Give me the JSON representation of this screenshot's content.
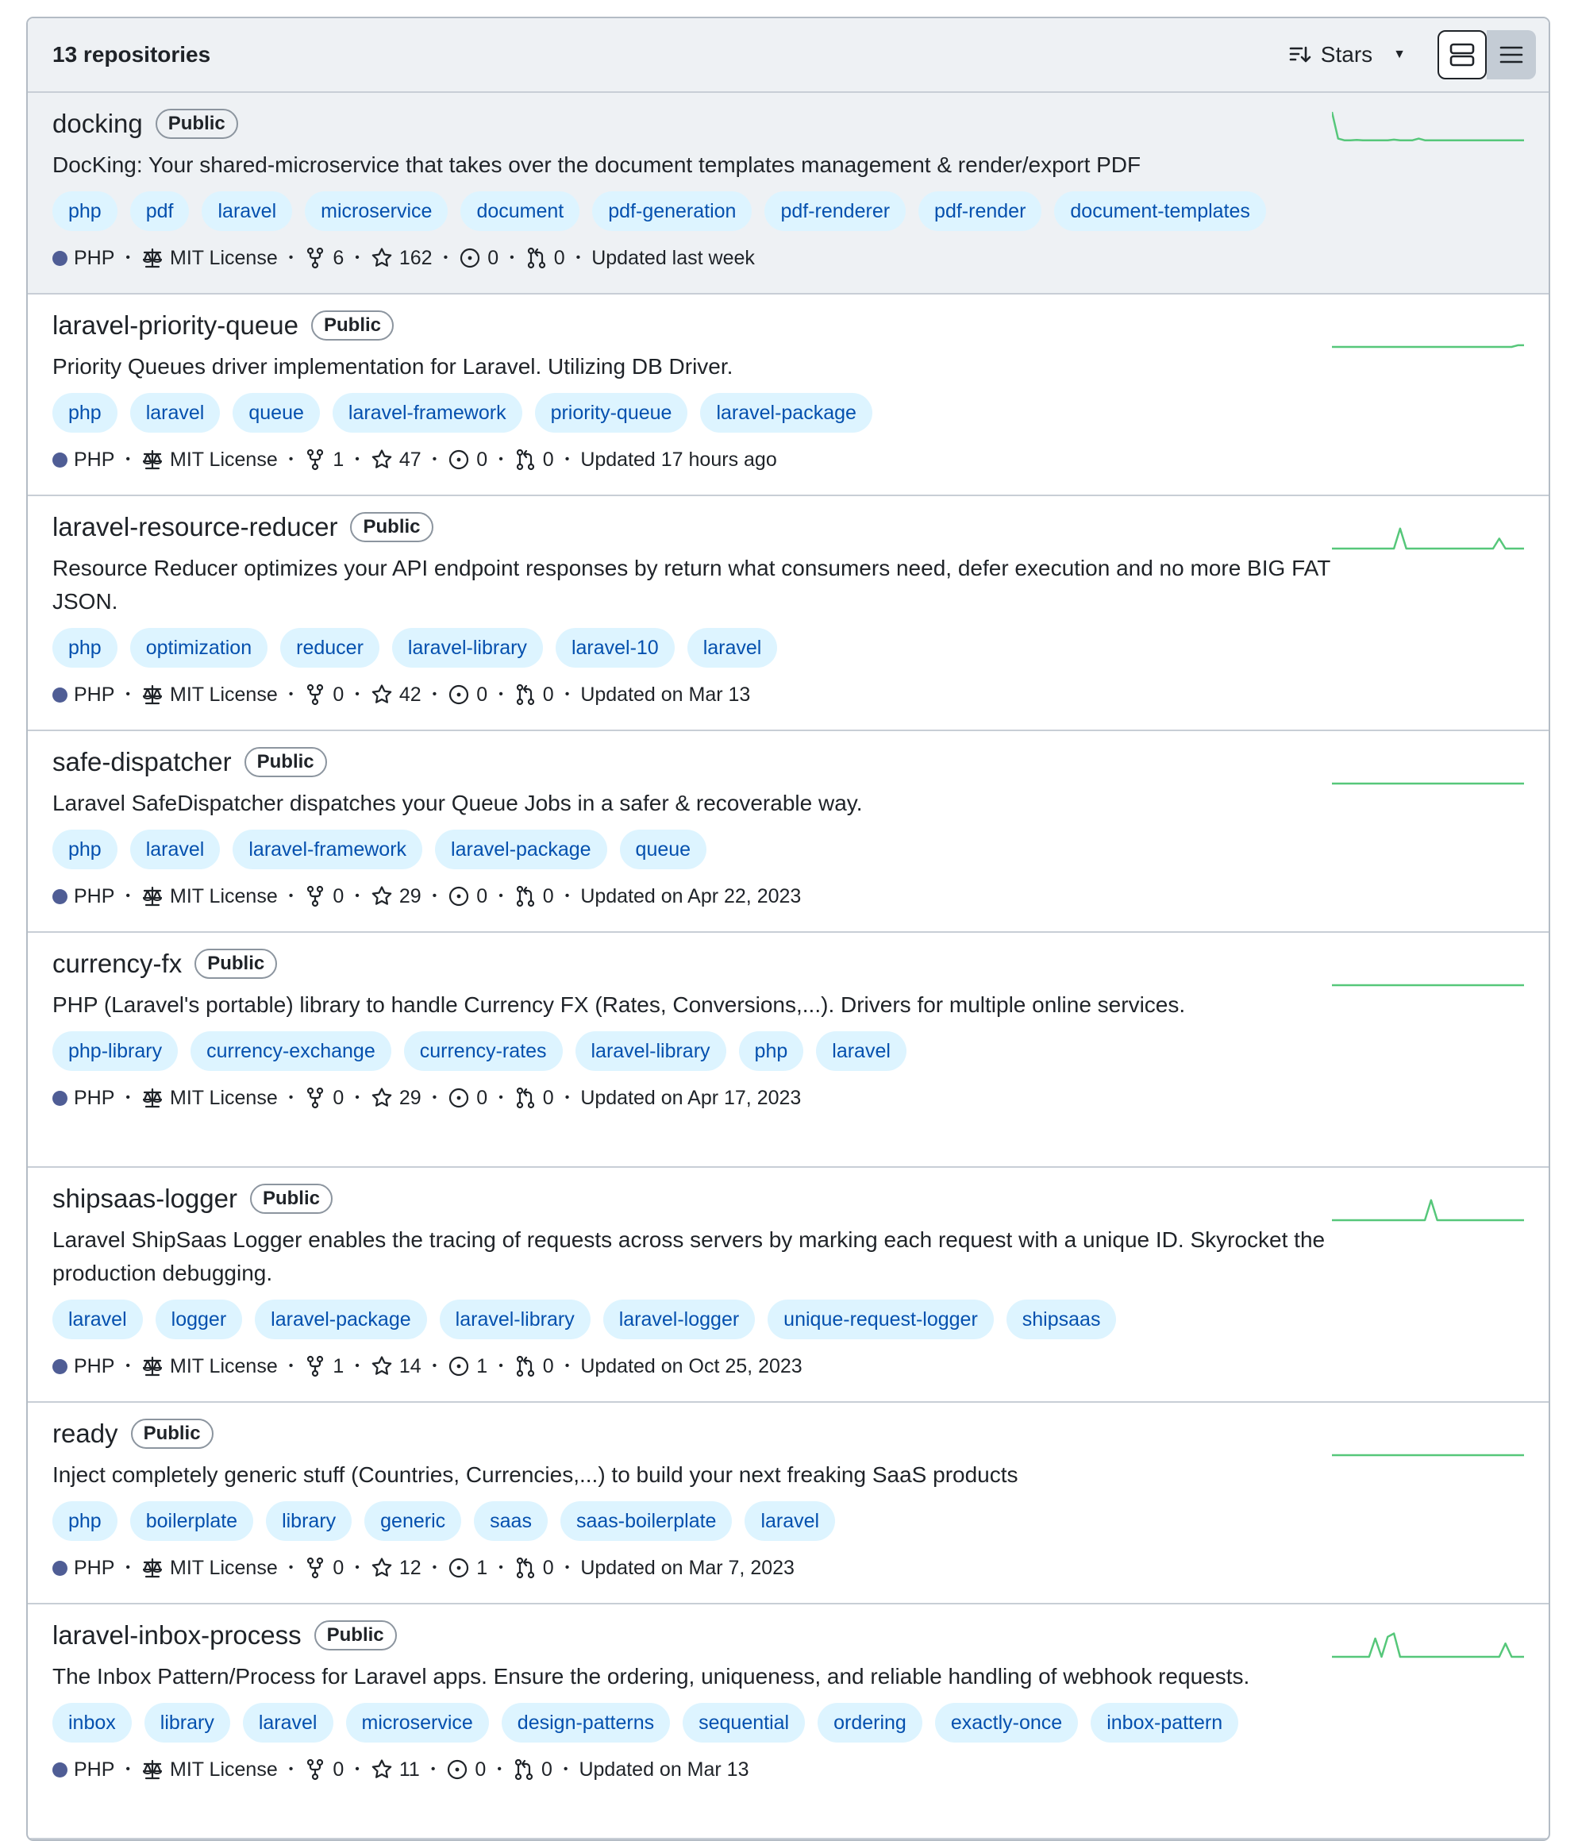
{
  "header": {
    "count_label": "13 repositories",
    "sort_label": "Stars"
  },
  "colors": {
    "php_language": "#4f5d95",
    "topic_bg": "#ddf4ff",
    "topic_text": "#0550ae",
    "sparkline": "#56c77a"
  },
  "icons": {
    "sort": "sort-descending-icon",
    "caret": "triangle-down-icon",
    "card_view": "card-view-icon",
    "list_view": "list-view-icon",
    "license": "law-scale-icon",
    "forks": "repo-forked-icon",
    "stars": "star-icon",
    "issues": "issue-opened-icon",
    "pulls": "git-pull-request-icon"
  },
  "repos": [
    {
      "name": "docking",
      "visibility": "Public",
      "description": "DocKing: Your shared-microservice that takes over the document templates management & render/export PDF",
      "topics": [
        "php",
        "pdf",
        "laravel",
        "microservice",
        "document",
        "pdf-generation",
        "pdf-renderer",
        "pdf-render",
        "document-templates"
      ],
      "language": "PHP",
      "license": "MIT License",
      "forks": "6",
      "stars": "162",
      "issues": "0",
      "pulls": "0",
      "updated": "Updated last week",
      "activity": [
        1,
        0.2,
        0.15,
        0.15,
        0.16,
        0.15,
        0.15,
        0.15,
        0.15,
        0.15,
        0.17,
        0.15,
        0.15,
        0.15,
        0.2,
        0.15,
        0.15,
        0.15,
        0.15,
        0.15,
        0.15,
        0.15,
        0.15,
        0.15,
        0.15,
        0.15,
        0.15,
        0.15,
        0.15,
        0.15,
        0.15,
        0.15
      ]
    },
    {
      "name": "laravel-priority-queue",
      "visibility": "Public",
      "description": "Priority Queues driver implementation for Laravel. Utilizing DB Driver.",
      "topics": [
        "php",
        "laravel",
        "queue",
        "laravel-framework",
        "priority-queue",
        "laravel-package"
      ],
      "language": "PHP",
      "license": "MIT License",
      "forks": "1",
      "stars": "47",
      "issues": "0",
      "pulls": "0",
      "updated": "Updated 17 hours ago",
      "activity": [
        0,
        0,
        0,
        0,
        0,
        0,
        0,
        0,
        0,
        0,
        0,
        0,
        0,
        0,
        0,
        0,
        0,
        0,
        0,
        0,
        0,
        0,
        0,
        0,
        0,
        0,
        0,
        0,
        0,
        0,
        0.05,
        0.05
      ]
    },
    {
      "name": "laravel-resource-reducer",
      "visibility": "Public",
      "description": "Resource Reducer optimizes your API endpoint responses by return what consumers need, defer execution and no more BIG FAT JSON.",
      "topics": [
        "php",
        "optimization",
        "reducer",
        "laravel-library",
        "laravel-10",
        "laravel"
      ],
      "language": "PHP",
      "license": "MIT License",
      "forks": "0",
      "stars": "42",
      "issues": "0",
      "pulls": "0",
      "updated": "Updated on Mar 13",
      "activity": [
        0,
        0,
        0,
        0,
        0,
        0,
        0,
        0,
        0,
        0,
        0,
        0.6,
        0,
        0,
        0,
        0,
        0,
        0,
        0,
        0,
        0,
        0,
        0,
        0,
        0,
        0,
        0,
        0.3,
        0,
        0,
        0,
        0
      ]
    },
    {
      "name": "safe-dispatcher",
      "visibility": "Public",
      "description": "Laravel SafeDispatcher dispatches your Queue Jobs in a safer & recoverable way.",
      "topics": [
        "php",
        "laravel",
        "laravel-framework",
        "laravel-package",
        "queue"
      ],
      "language": "PHP",
      "license": "MIT License",
      "forks": "0",
      "stars": "29",
      "issues": "0",
      "pulls": "0",
      "updated": "Updated on Apr 22, 2023",
      "activity": [
        0,
        0,
        0,
        0,
        0,
        0,
        0,
        0,
        0,
        0,
        0,
        0,
        0,
        0,
        0,
        0,
        0,
        0,
        0,
        0,
        0,
        0,
        0,
        0,
        0,
        0,
        0,
        0,
        0,
        0,
        0,
        0
      ]
    },
    {
      "name": "currency-fx",
      "visibility": "Public",
      "description": "PHP (Laravel's portable) library to handle Currency FX (Rates, Conversions,...). Drivers for multiple online services.",
      "topics": [
        "php-library",
        "currency-exchange",
        "currency-rates",
        "laravel-library",
        "php",
        "laravel"
      ],
      "language": "PHP",
      "license": "MIT License",
      "forks": "0",
      "stars": "29",
      "issues": "0",
      "pulls": "0",
      "updated": "Updated on Apr 17, 2023",
      "activity": [
        0,
        0,
        0,
        0,
        0,
        0,
        0,
        0,
        0,
        0,
        0,
        0,
        0,
        0,
        0,
        0,
        0,
        0,
        0,
        0,
        0,
        0,
        0,
        0,
        0,
        0,
        0,
        0,
        0,
        0,
        0,
        0
      ]
    },
    {
      "name": "shipsaas-logger",
      "visibility": "Public",
      "description": "Laravel ShipSaas Logger enables the tracing of requests across servers by marking each request with a unique ID. Skyrocket the production debugging.",
      "topics": [
        "laravel",
        "logger",
        "laravel-package",
        "laravel-library",
        "laravel-logger",
        "unique-request-logger",
        "shipsaas"
      ],
      "language": "PHP",
      "license": "MIT License",
      "forks": "1",
      "stars": "14",
      "issues": "1",
      "pulls": "0",
      "updated": "Updated on Oct 25, 2023",
      "activity": [
        0,
        0,
        0,
        0,
        0,
        0,
        0,
        0,
        0,
        0,
        0,
        0,
        0,
        0,
        0,
        0,
        0.6,
        0,
        0,
        0,
        0,
        0,
        0,
        0,
        0,
        0,
        0,
        0,
        0,
        0,
        0,
        0
      ]
    },
    {
      "name": "ready",
      "visibility": "Public",
      "description": "Inject completely generic stuff (Countries, Currencies,...) to build your next freaking SaaS products",
      "topics": [
        "php",
        "boilerplate",
        "library",
        "generic",
        "saas",
        "saas-boilerplate",
        "laravel"
      ],
      "language": "PHP",
      "license": "MIT License",
      "forks": "0",
      "stars": "12",
      "issues": "1",
      "pulls": "0",
      "updated": "Updated on Mar 7, 2023",
      "activity": [
        0,
        0,
        0,
        0,
        0,
        0,
        0,
        0,
        0,
        0,
        0,
        0,
        0,
        0,
        0,
        0,
        0,
        0,
        0,
        0,
        0,
        0,
        0,
        0,
        0,
        0,
        0,
        0,
        0,
        0,
        0,
        0
      ]
    },
    {
      "name": "laravel-inbox-process",
      "visibility": "Public",
      "description": "The Inbox Pattern/Process for Laravel apps. Ensure the ordering, uniqueness, and reliable handling of webhook requests.",
      "topics": [
        "inbox",
        "library",
        "laravel",
        "microservice",
        "design-patterns",
        "sequential",
        "ordering",
        "exactly-once",
        "inbox-pattern"
      ],
      "language": "PHP",
      "license": "MIT License",
      "forks": "0",
      "stars": "11",
      "issues": "0",
      "pulls": "0",
      "updated": "Updated on Mar 13",
      "activity": [
        0,
        0,
        0,
        0,
        0,
        0,
        0,
        0.55,
        0,
        0.6,
        0.7,
        0,
        0,
        0,
        0,
        0,
        0,
        0,
        0,
        0,
        0,
        0,
        0,
        0,
        0,
        0,
        0,
        0,
        0.4,
        0,
        0,
        0
      ]
    }
  ]
}
